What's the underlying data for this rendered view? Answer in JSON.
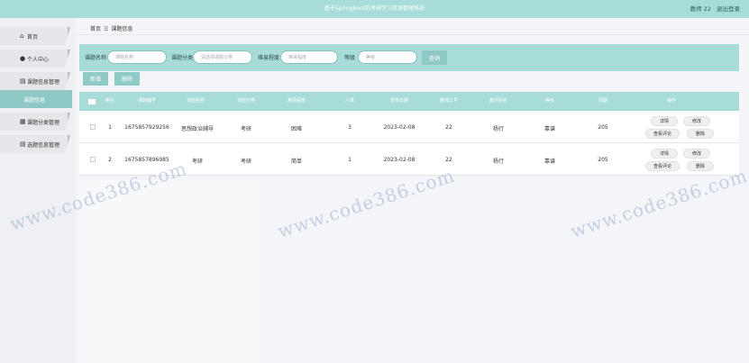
{
  "header": {
    "title": "基于SpringBoot的考研学习资源管理系统",
    "user": "教师 22",
    "logout": "退出登录"
  },
  "sidebar": {
    "items": [
      {
        "label": "首页",
        "icon": "home-icon"
      },
      {
        "label": "个人中心",
        "icon": "user-icon"
      },
      {
        "label": "课题信息管理",
        "icon": "folder-icon"
      },
      {
        "label": "课题信息",
        "icon": ""
      },
      {
        "label": "课题分类管理",
        "icon": "grid-icon"
      },
      {
        "label": "选题信息管理",
        "icon": "folder-icon"
      }
    ]
  },
  "breadcrumb": {
    "home": "首页",
    "sep": "☰",
    "current": "课题信息"
  },
  "search": {
    "fields": [
      {
        "label": "课题名称",
        "placeholder": "课题名称"
      },
      {
        "label": "课题分类",
        "placeholder": "请选择课题分类"
      },
      {
        "label": "难易程度",
        "placeholder": "难易程度"
      },
      {
        "label": "等级",
        "placeholder": "等级"
      }
    ],
    "query_label": "查询"
  },
  "actions": {
    "add": "新增",
    "delete": "删除"
  },
  "table": {
    "headers": [
      "索引",
      "课题编号",
      "课题名称",
      "课题分类",
      "难易程度",
      "人数",
      "发布日期",
      "教师工号",
      "教师姓名",
      "等级",
      "周期"
    ],
    "op_header": "操作",
    "rows": [
      {
        "index": "1",
        "code": "1675857929256",
        "name": "思想政治辅导",
        "category": "考研",
        "difficulty": "困难",
        "people": "3",
        "date": "2023-02-08",
        "tid": "22",
        "tname": "杨行",
        "level": "靠谱",
        "cycle": "205"
      },
      {
        "index": "2",
        "code": "1675857896985",
        "name": "考研",
        "category": "考研",
        "difficulty": "简单",
        "people": "1",
        "date": "2023-02-08",
        "tid": "22",
        "tname": "杨行",
        "level": "靠谱",
        "cycle": "205"
      }
    ],
    "row_buttons": {
      "detail": "详情",
      "edit": "修改",
      "comment": "查看评论",
      "delete": "删除"
    }
  },
  "watermark": "www.code386.com"
}
